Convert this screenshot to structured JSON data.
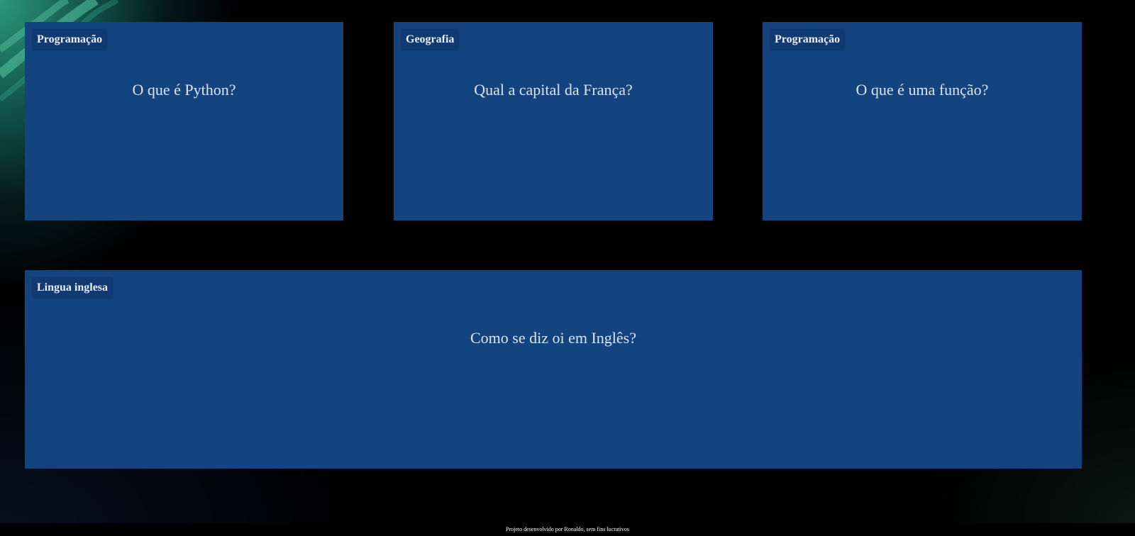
{
  "flashcards": [
    {
      "category": "Programação",
      "question": "O que é Python?"
    },
    {
      "category": "Geografia",
      "question": "Qual a capital da França?"
    },
    {
      "category": "Programação",
      "question": "O que é uma função?"
    },
    {
      "category": "Lingua inglesa",
      "question": "Como se diz oi em Inglês?"
    }
  ],
  "footer": {
    "text": "Projeto desenvolvido por Ronaldo, sem fins lucrativos"
  },
  "colors": {
    "card_background": "#134480",
    "page_background": "#000000",
    "accent_green": "#2ea080"
  }
}
